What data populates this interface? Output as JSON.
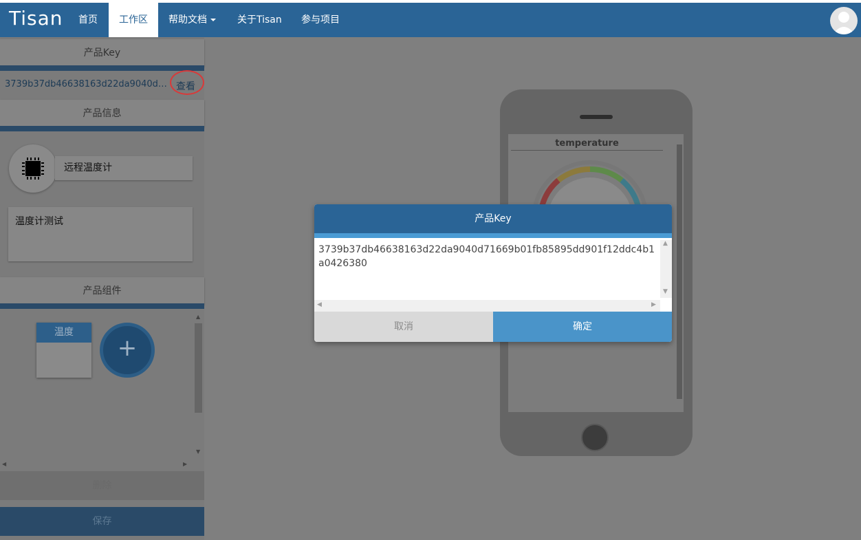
{
  "nav": {
    "brand": "Tisan",
    "items": [
      {
        "label": "首页"
      },
      {
        "label": "工作区"
      },
      {
        "label": "帮助文档"
      },
      {
        "label": "关于Tisan"
      },
      {
        "label": "参与项目"
      }
    ]
  },
  "sidebar": {
    "product_key_header": "产品Key",
    "product_key_value": "3739b37db46638163d22da9040d71669b01fb85895dd901f12ddc4b1a0426380",
    "view_button": "查看",
    "product_info_header": "产品信息",
    "product_name": "远程温度计",
    "product_description": "温度计测试",
    "components_header": "产品组件",
    "component_card_label": "温度",
    "add_label": "+",
    "delete_button": "删除",
    "save_button": "保存"
  },
  "phone": {
    "widget_title": "temperature"
  },
  "modal": {
    "title": "产品Key",
    "content": "3739b37db46638163d22da9040d71669b01fb85895dd901f12ddc4b1a0426380",
    "cancel_button": "取消",
    "ok_button": "确定"
  },
  "colors": {
    "primary": "#2a6496",
    "accent": "#4a94c9",
    "highlight_ring": "#d83a3a"
  }
}
